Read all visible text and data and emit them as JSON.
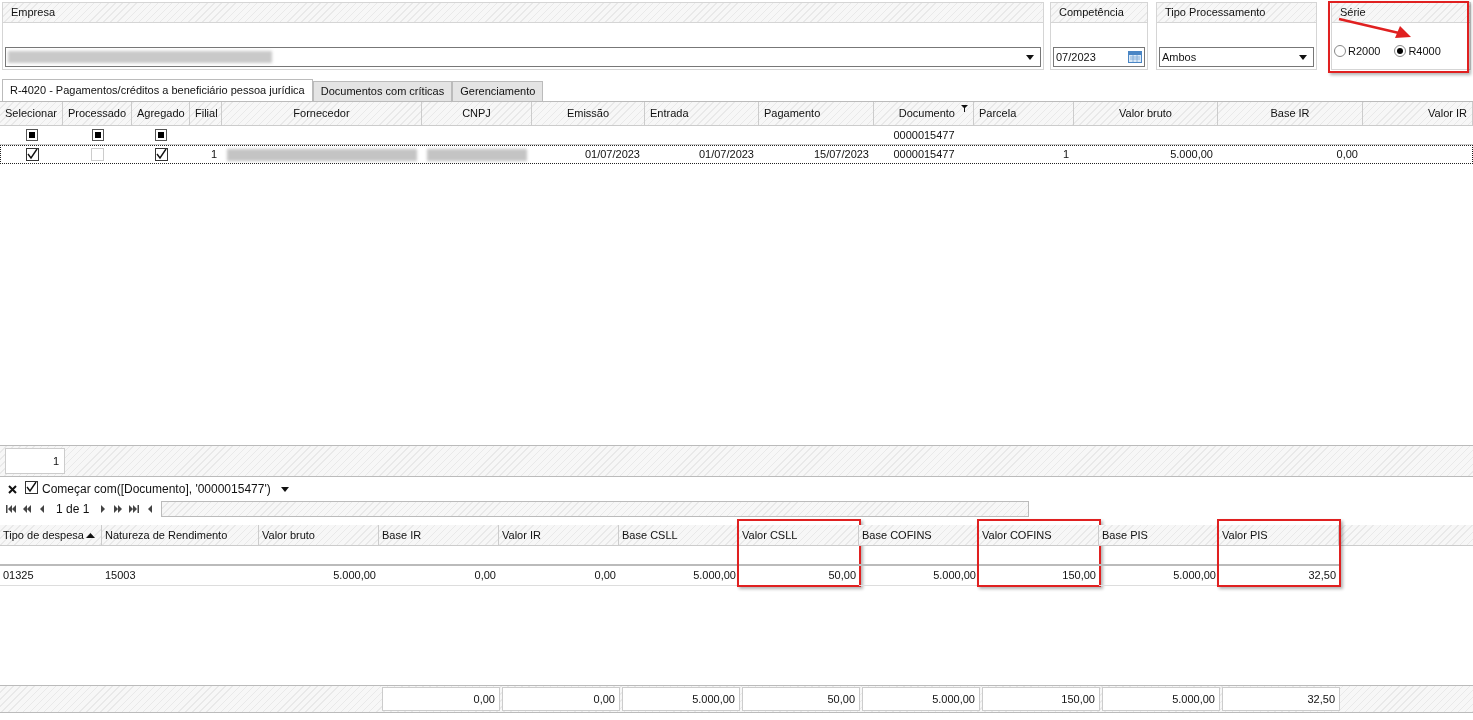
{
  "empresa": {
    "label": "Empresa"
  },
  "competencia": {
    "label": "Competência",
    "value": "07/2023"
  },
  "tipo_processamento": {
    "label": "Tipo Processamento",
    "value": "Ambos"
  },
  "serie": {
    "label": "Série",
    "highlighted": true,
    "options": [
      {
        "label": "R2000",
        "selected": false
      },
      {
        "label": "R4000",
        "selected": true
      }
    ]
  },
  "tabs": [
    {
      "label": "R-4020 - Pagamentos/créditos a beneficiário pessoa jurídica",
      "selected": true
    },
    {
      "label": "Documentos com críticas",
      "selected": false
    },
    {
      "label": "Gerenciamento",
      "selected": false
    }
  ],
  "grid": {
    "columns": [
      {
        "label": "Selecionar"
      },
      {
        "label": "Processado"
      },
      {
        "label": "Agregado"
      },
      {
        "label": "Filial"
      },
      {
        "label": "Fornecedor"
      },
      {
        "label": "CNPJ"
      },
      {
        "label": "Emissão"
      },
      {
        "label": "Entrada"
      },
      {
        "label": "Pagamento"
      },
      {
        "label": "Documento",
        "filtered": true
      },
      {
        "label": "Parcela"
      },
      {
        "label": "Valor bruto"
      },
      {
        "label": "Base IR"
      },
      {
        "label": "Valor IR"
      }
    ],
    "filter_row": [
      {
        "kind": "check",
        "checked": true
      },
      {
        "kind": "check",
        "checked": true
      },
      {
        "kind": "check",
        "checked": true
      },
      {
        "kind": "empty"
      },
      {
        "kind": "empty"
      },
      {
        "kind": "empty"
      },
      {
        "kind": "empty"
      },
      {
        "kind": "empty"
      },
      {
        "kind": "empty"
      },
      {
        "kind": "text",
        "text": "0000015477"
      },
      {
        "kind": "empty"
      },
      {
        "kind": "empty"
      },
      {
        "kind": "empty"
      },
      {
        "kind": "empty"
      }
    ],
    "rows": [
      {
        "selected": true,
        "cells": [
          {
            "kind": "check",
            "checked": true
          },
          {
            "kind": "check",
            "checked": false
          },
          {
            "kind": "check",
            "checked": true
          },
          {
            "kind": "text",
            "text": "1"
          },
          {
            "kind": "blurred"
          },
          {
            "kind": "blurred"
          },
          {
            "kind": "text",
            "text": "01/07/2023"
          },
          {
            "kind": "text",
            "text": "01/07/2023"
          },
          {
            "kind": "text",
            "text": "15/07/2023"
          },
          {
            "kind": "text",
            "text": "0000015477"
          },
          {
            "kind": "text",
            "text": "1"
          },
          {
            "kind": "text",
            "text": "5.000,00"
          },
          {
            "kind": "text",
            "text": "0,00"
          },
          {
            "kind": "empty"
          }
        ]
      }
    ]
  },
  "record_count": "1",
  "filter": {
    "active": true,
    "text": "Começar com([Documento], '0000015477')"
  },
  "navigator": {
    "page": "1 de 1"
  },
  "detail_grid": {
    "columns": [
      {
        "label": "Tipo de despesa",
        "sorted": true,
        "highlighted": false
      },
      {
        "label": "Natureza de Rendimento",
        "sorted": false,
        "highlighted": false
      },
      {
        "label": "Valor bruto",
        "sorted": false,
        "highlighted": false
      },
      {
        "label": "Base IR",
        "sorted": false,
        "highlighted": false
      },
      {
        "label": "Valor IR",
        "sorted": false,
        "highlighted": false
      },
      {
        "label": "Base CSLL",
        "sorted": false,
        "highlighted": false
      },
      {
        "label": "Valor CSLL",
        "sorted": false,
        "highlighted": true
      },
      {
        "label": "Base COFINS",
        "sorted": false,
        "highlighted": false
      },
      {
        "label": "Valor COFINS",
        "sorted": false,
        "highlighted": true
      },
      {
        "label": "Base PIS",
        "sorted": false,
        "highlighted": false
      },
      {
        "label": "Valor PIS",
        "sorted": false,
        "highlighted": true
      }
    ],
    "rows": [
      [
        "01325",
        "15003",
        "5.000,00",
        "0,00",
        "0,00",
        "5.000,00",
        "50,00",
        "5.000,00",
        "150,00",
        "5.000,00",
        "32,50"
      ]
    ],
    "totals": [
      "0,00",
      "0,00",
      "5.000,00",
      "50,00",
      "5.000,00",
      "150,00",
      "5.000,00",
      "32,50"
    ]
  }
}
